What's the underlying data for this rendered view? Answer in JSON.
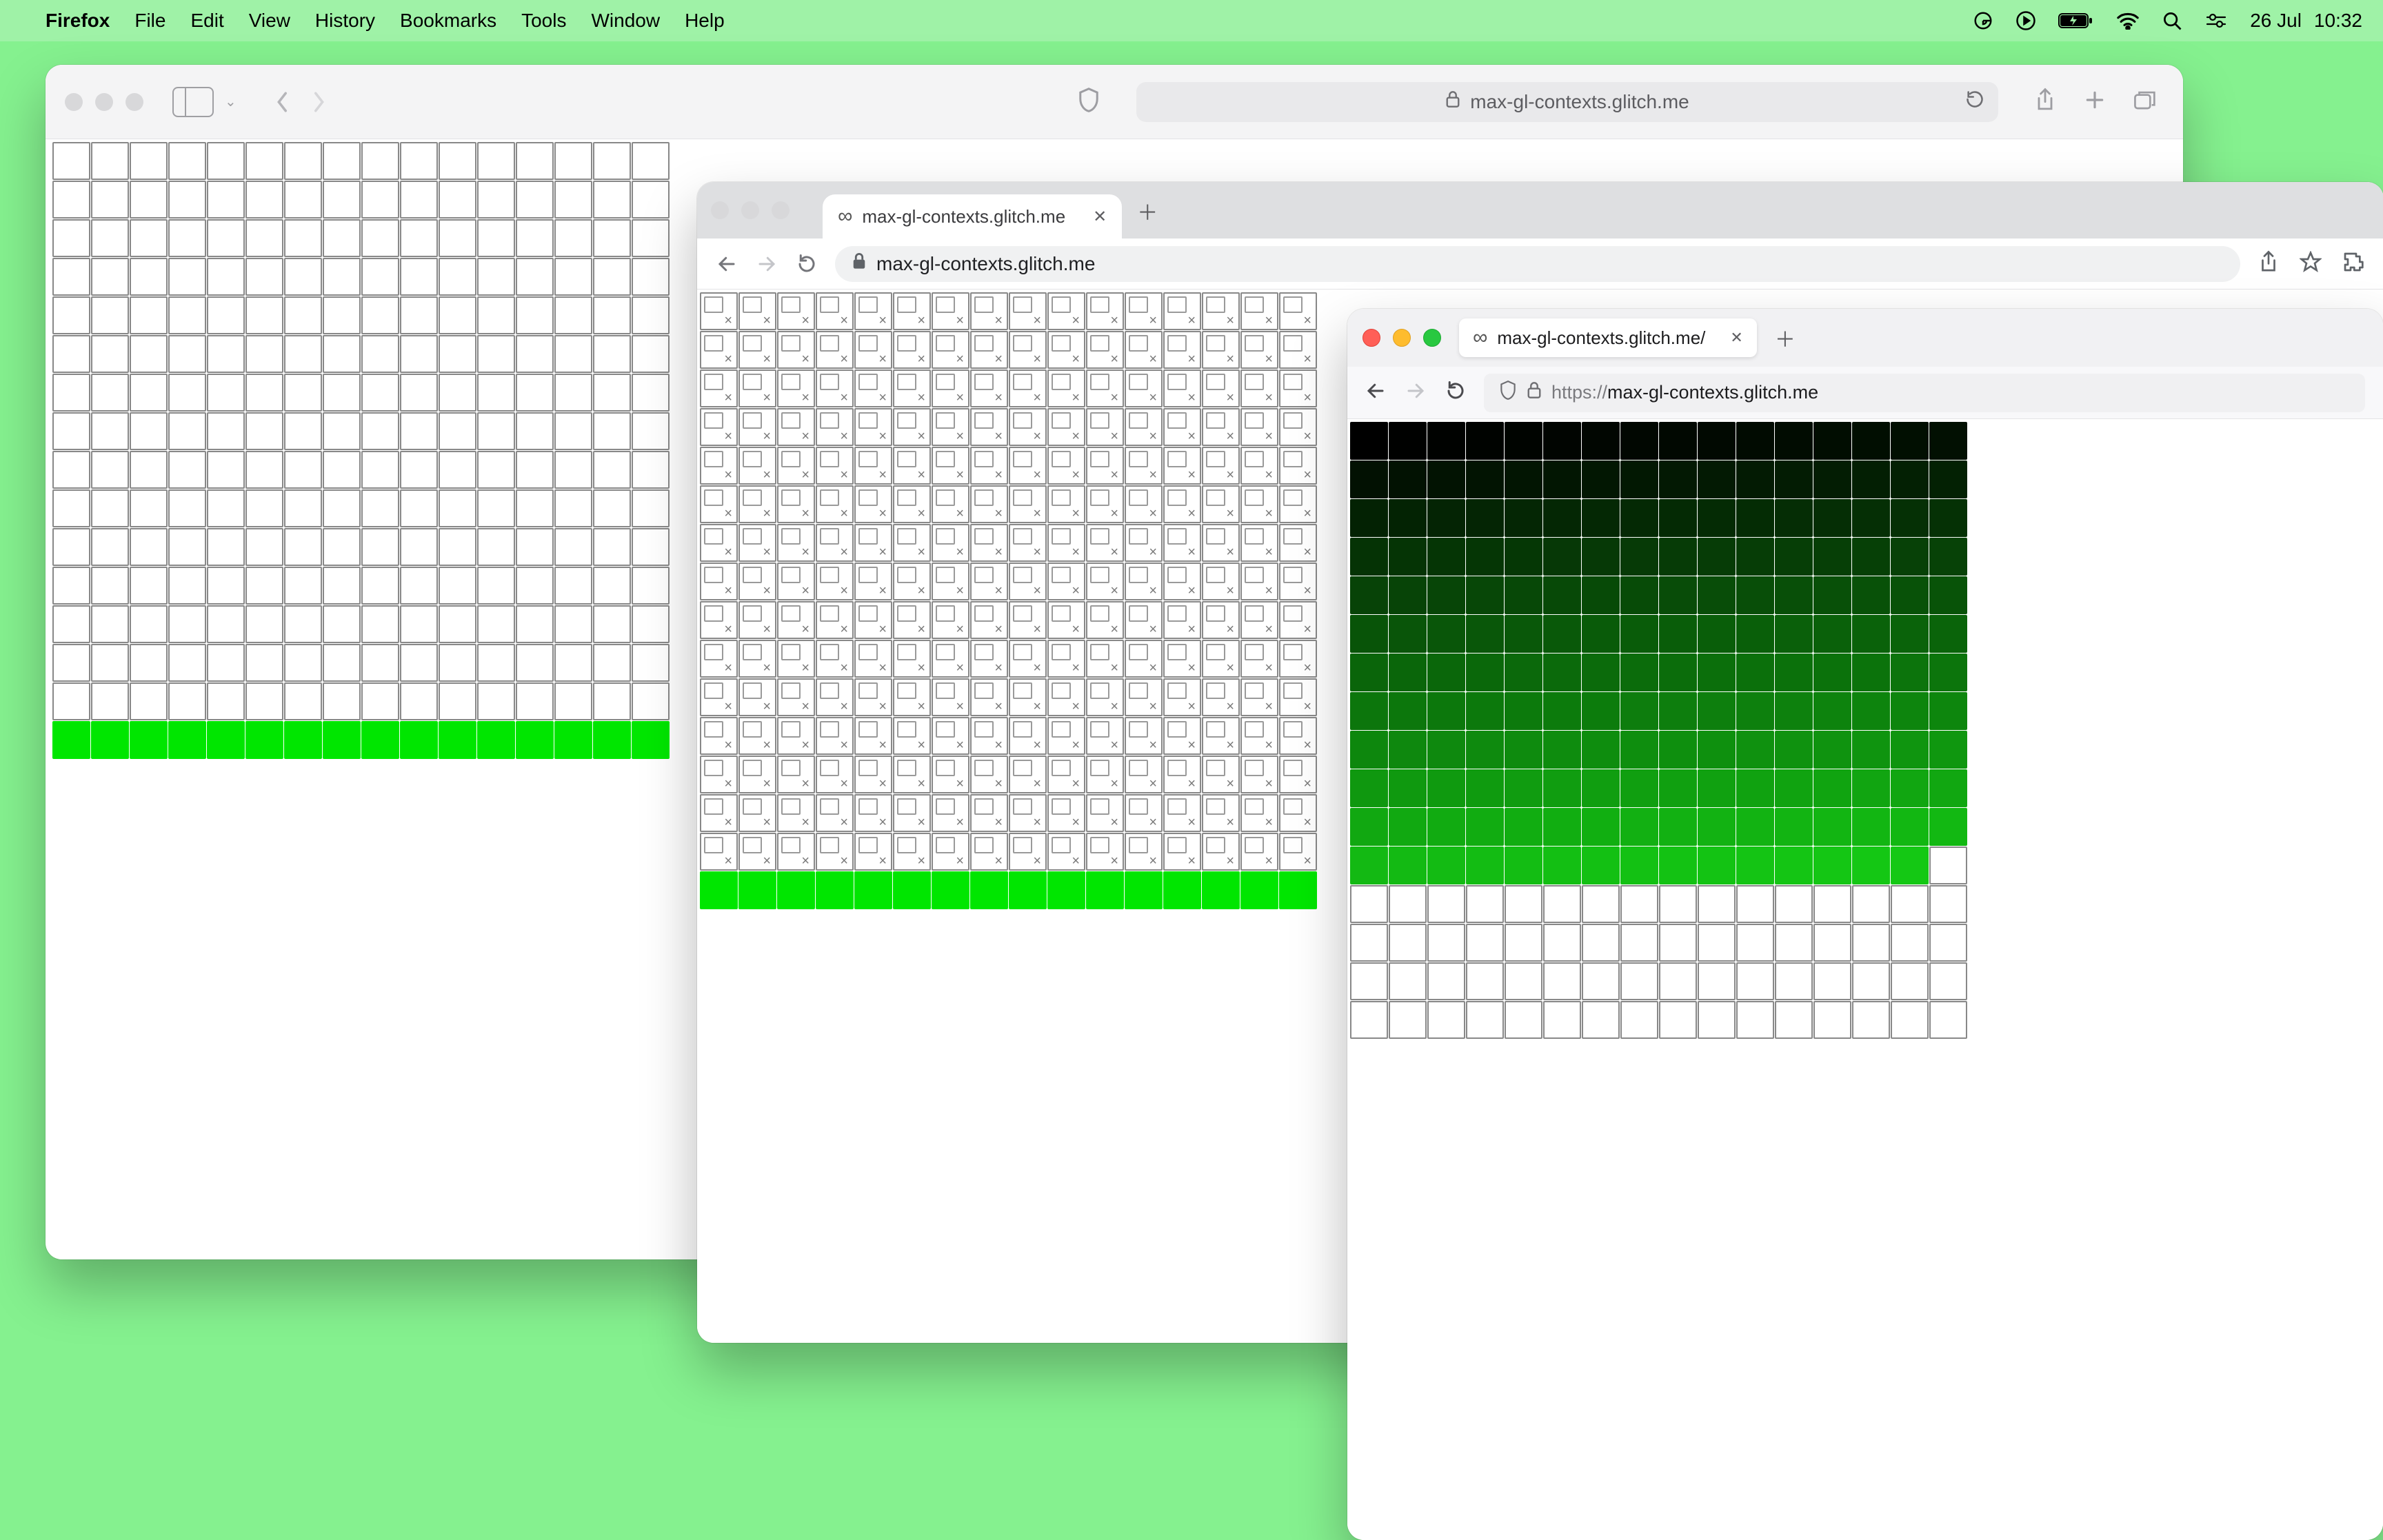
{
  "colors": {
    "desktop": "#85f18f",
    "menubar": "#9ff2a7",
    "accent_green": "#00e600"
  },
  "menubar": {
    "app_name": "Firefox",
    "menus": [
      "File",
      "Edit",
      "View",
      "History",
      "Bookmarks",
      "Tools",
      "Window",
      "Help"
    ],
    "date": "26 Jul",
    "time": "10:32"
  },
  "safari": {
    "url_display": "max-gl-contexts.glitch.me",
    "grid": {
      "cols": 16,
      "rows": 16,
      "green_last_row": true
    }
  },
  "chrome": {
    "tab_title": "max-gl-contexts.glitch.me",
    "url_display": "max-gl-contexts.glitch.me",
    "grid": {
      "cols": 16,
      "rows": 16,
      "green_last_row": true,
      "broken_rows": 15
    }
  },
  "firefox": {
    "tab_title": "max-gl-contexts.glitch.me/",
    "url_protocol": "https://",
    "url_host": "max-gl-contexts.glitch.me",
    "grid": {
      "cols": 16,
      "rows": 16,
      "gradient_cells": 191
    }
  }
}
